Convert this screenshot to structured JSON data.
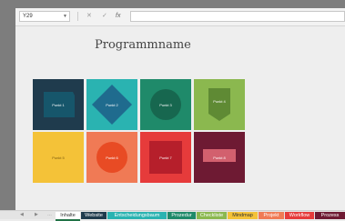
{
  "formula_bar": {
    "name_box": "Y29",
    "cancel_symbol": "✕",
    "enter_symbol": "✓",
    "fx_symbol": "fx",
    "formula_value": ""
  },
  "sheet": {
    "title": "Programmname",
    "tiles": [
      {
        "label": "Punkt 1",
        "color": "#1f3b4d"
      },
      {
        "label": "Punkt 2",
        "color": "#2ab3b1"
      },
      {
        "label": "Punkt 3",
        "color": "#1f8a6a"
      },
      {
        "label": "Punkt 4",
        "color": "#8bb84f"
      },
      {
        "label": "Punkt 5",
        "color": "#f4c238"
      },
      {
        "label": "Punkt 6",
        "color": "#f07a55"
      },
      {
        "label": "Punkt 7",
        "color": "#e63b3b"
      },
      {
        "label": "Punkt 8",
        "color": "#6e1a33"
      }
    ]
  },
  "tabs": [
    {
      "label": "Inhalte",
      "color": "#ffffff",
      "text": "#333333",
      "active": true
    },
    {
      "label": "Website",
      "color": "#1f3b4d",
      "text": "#ffffff"
    },
    {
      "label": "Entscheidungsbaum",
      "color": "#2ab3b1",
      "text": "#ffffff"
    },
    {
      "label": "Prozedur",
      "color": "#1f8a6a",
      "text": "#ffffff"
    },
    {
      "label": "Checkliste",
      "color": "#8bb84f",
      "text": "#ffffff"
    },
    {
      "label": "Mindmap",
      "color": "#f4c238",
      "text": "#333333"
    },
    {
      "label": "Projekt",
      "color": "#f07a55",
      "text": "#ffffff"
    },
    {
      "label": "Workflow",
      "color": "#e63b3b",
      "text": "#ffffff"
    },
    {
      "label": "Prozess",
      "color": "#6e1a33",
      "text": "#ffffff"
    }
  ]
}
